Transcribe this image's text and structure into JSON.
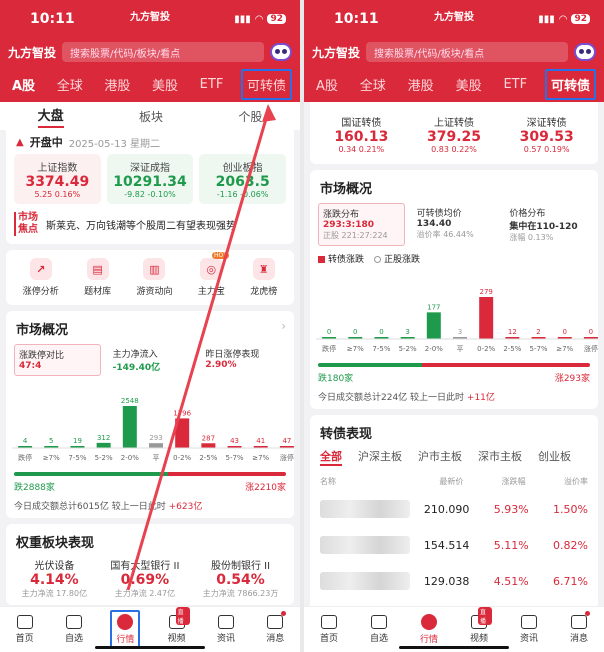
{
  "status": {
    "time": "10:11",
    "brand": "九方智投",
    "battery": "92"
  },
  "header": {
    "logo": "九方智投",
    "search_placeholder": "搜索股票/代码/板块/看点"
  },
  "market_tabs": [
    "A股",
    "全球",
    "港股",
    "美股",
    "ETF",
    "可转债"
  ],
  "left": {
    "subtabs": [
      "大盘",
      "板块",
      "个股"
    ],
    "open_status": "开盘中",
    "date": "2025-05-13 星期二",
    "indices": [
      {
        "name": "上证指数",
        "value": "3374.49",
        "chg": "5.25  0.16%",
        "dir": "up"
      },
      {
        "name": "深证成指",
        "value": "10291.34",
        "chg": "-9.82  -0.10%",
        "dir": "dn"
      },
      {
        "name": "创业板指",
        "value": "2063.5",
        "chg": "-1.16  -0.06%",
        "dir": "dn"
      }
    ],
    "news_tag": [
      "市场",
      "焦点"
    ],
    "news_text": "斯莱克、万向钱潮等个股周二有望表现强势",
    "tools": [
      {
        "label": "涨停分析",
        "icon": "↗"
      },
      {
        "label": "题材库",
        "icon": "▤"
      },
      {
        "label": "游资动向",
        "icon": "▥"
      },
      {
        "label": "主力宝",
        "icon": "◎",
        "badge": "HOT"
      },
      {
        "label": "龙虎榜",
        "icon": "♜"
      }
    ],
    "market_title": "市场概况",
    "market_boxes": [
      {
        "label": "涨跌停对比",
        "value": "47:4"
      },
      {
        "label": "主力净流入",
        "value": "-149.40亿"
      },
      {
        "label": "昨日涨停表现",
        "value": "2.90%"
      }
    ],
    "dist_counts": [
      "4",
      "5",
      "19",
      "312",
      "2548",
      "293",
      "1796",
      "287",
      "43",
      "41",
      "47"
    ],
    "dist_labels": [
      "跌停",
      "≥7%",
      "7-5%",
      "5-2%",
      "2-0%",
      "平",
      "0-2%",
      "2-5%",
      "5-7%",
      "≥7%",
      "涨停"
    ],
    "fall_text": "跌2888家",
    "rise_text": "涨2210家",
    "summary": "今日成交额总计6015亿 较上一日此时 ",
    "summary_delta": "+623亿",
    "sector_title": "权重板块表现",
    "sectors": [
      {
        "name": "光伏设备",
        "value": "4.14%",
        "sub": "主力净流 17.80亿"
      },
      {
        "name": "国有大型银行 II",
        "value": "0.69%",
        "sub": "主力净流 2.47亿"
      },
      {
        "name": "股份制银行 II",
        "value": "0.54%",
        "sub": "主力净流 7866.23万"
      }
    ]
  },
  "right": {
    "cbs": [
      {
        "name": "国证转债",
        "value": "160.13",
        "chg": "0.34  0.21%"
      },
      {
        "name": "上证转债",
        "value": "379.25",
        "chg": "0.83  0.22%"
      },
      {
        "name": "深证转债",
        "value": "309.53",
        "chg": "0.57  0.19%"
      }
    ],
    "market_title": "市场概况",
    "market_boxes": [
      {
        "label": "涨跌分布",
        "value": "293:3:180",
        "sub": "正股 221:27:224"
      },
      {
        "label": "可转债均价",
        "value": "134.40",
        "sub": "溢价率 46.44%"
      },
      {
        "label": "价格分布",
        "value": "集中在110-120",
        "sub": "涨幅 0.13%"
      }
    ],
    "legend": [
      "转债涨跌",
      "正股涨跌"
    ],
    "dist_counts": [
      "0",
      "0",
      "0",
      "3",
      "177",
      "3",
      "279",
      "12",
      "2",
      "0",
      "0"
    ],
    "dist_labels": [
      "跌停",
      "≥7%",
      "7-5%",
      "5-2%",
      "2-0%",
      "平",
      "0-2%",
      "2-5%",
      "5-7%",
      "≥7%",
      "涨停"
    ],
    "fall_text": "跌180家",
    "rise_text": "涨293家",
    "summary": "今日成交额总计224亿 较上一日此时 ",
    "summary_delta": "+11亿",
    "perf_title": "转债表现",
    "perf_tabs": [
      "全部",
      "沪深主板",
      "沪市主板",
      "深市主板",
      "创业板"
    ],
    "table_head": [
      "名称",
      "最新价",
      "涨跌幅",
      "溢价率"
    ],
    "rows": [
      {
        "price": "210.090",
        "chg": "5.93%",
        "prem": "1.50%"
      },
      {
        "price": "154.514",
        "chg": "5.11%",
        "prem": "0.82%"
      },
      {
        "price": "129.038",
        "chg": "4.51%",
        "prem": "6.71%"
      }
    ]
  },
  "nav": [
    "首页",
    "自选",
    "行情",
    "视频",
    "资讯",
    "消息"
  ],
  "nav_badge": "直播",
  "colors": {
    "red": "#d9293a",
    "green": "#1f9a4c",
    "highlight": "#2b6fe6"
  }
}
